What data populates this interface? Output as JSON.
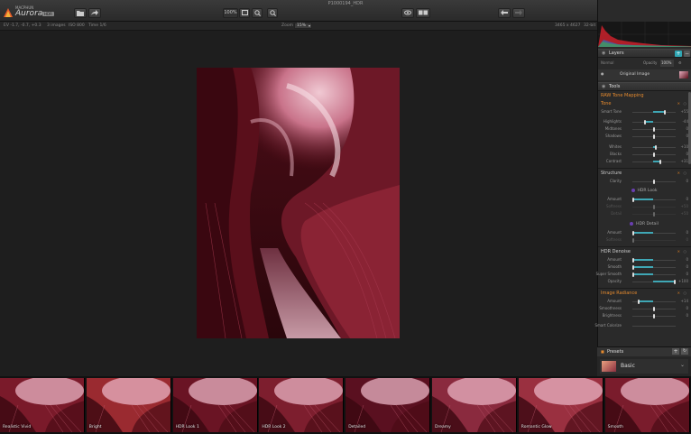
{
  "app": {
    "window_title": "P1000194_HDR",
    "brand": "MACPHUN",
    "name": "Aurora",
    "badge": "HDR"
  },
  "toolbar": {
    "zoom_percent": "100%"
  },
  "infobar": {
    "ev": "EV -1.7, -0.7, +0.3",
    "images": "3 images",
    "iso": "ISO 800",
    "time": "Time 1/6",
    "zoom_label": "Zoom",
    "zoom_value": "15%",
    "dimensions": "3465 x 4627",
    "bitdepth": "32-bit"
  },
  "layers": {
    "title": "Layers",
    "blend_mode": "Normal",
    "opacity_label": "Opacity",
    "opacity_value": "100%",
    "layer_name": "Original Image"
  },
  "tools": {
    "title": "Tools",
    "raw_tone_mapping": "RAW Tone Mapping",
    "tone": {
      "title": "Tone",
      "rows": [
        {
          "label": "Smart Tone",
          "value": "+55",
          "level": 0.75
        },
        {
          "label": "Highlights",
          "value": "-44",
          "level": 0.28
        },
        {
          "label": "Midtones",
          "value": "0",
          "level": 0.5
        },
        {
          "label": "Shadows",
          "value": "0",
          "level": 0.5
        },
        {
          "label": "Whites",
          "value": "+10",
          "level": 0.55
        },
        {
          "label": "Blacks",
          "value": "0",
          "level": 0.5
        },
        {
          "label": "Contrast",
          "value": "+31",
          "level": 0.65
        }
      ]
    },
    "structure": {
      "title": "Structure",
      "clarity": {
        "label": "Clarity",
        "value": "0",
        "level": 0.5
      },
      "hdr_look": {
        "title": "HDR Look",
        "rows": [
          {
            "label": "Amount",
            "value": "0",
            "level": 0.0,
            "dim": false
          },
          {
            "label": "Softness",
            "value": "+50",
            "level": 0.5,
            "dim": true
          },
          {
            "label": "Detail",
            "value": "+50",
            "level": 0.5,
            "dim": true
          }
        ]
      },
      "hdr_detail": {
        "title": "HDR Detail",
        "rows": [
          {
            "label": "Amount",
            "value": "0",
            "level": 0.0,
            "dim": false
          },
          {
            "label": "Softness",
            "value": "0",
            "level": 0.0,
            "dim": true
          }
        ]
      }
    },
    "hdr_denoise": {
      "title": "HDR Denoise",
      "rows": [
        {
          "label": "Amount",
          "value": "0",
          "level": 0.0
        },
        {
          "label": "Smooth",
          "value": "0",
          "level": 0.0
        },
        {
          "label": "Super Smooth",
          "value": "0",
          "level": 0.0
        },
        {
          "label": "Opacity",
          "value": "+100",
          "level": 1.0
        }
      ]
    },
    "image_radiance": {
      "title": "Image Radiance",
      "rows": [
        {
          "label": "Amount",
          "value": "+14",
          "level": 0.14
        },
        {
          "label": "Smoothness",
          "value": "0",
          "level": 0.5
        },
        {
          "label": "Brightness",
          "value": "0",
          "level": 0.5
        }
      ],
      "smart_colorize": "Smart Colorize"
    }
  },
  "presets": {
    "title": "Presets",
    "category": "Basic",
    "items": [
      "Realistic Vivid",
      "Bright",
      "HDR Look 1",
      "HDR Look 2",
      "Detailed",
      "Dreamy",
      "Romantic Glow",
      "Smooth"
    ]
  },
  "colors": {
    "accent": "#e58a2e",
    "slider": "#3fa7b5",
    "photo_dark": "#3a0b12",
    "photo_light": "#d9a8b8"
  }
}
